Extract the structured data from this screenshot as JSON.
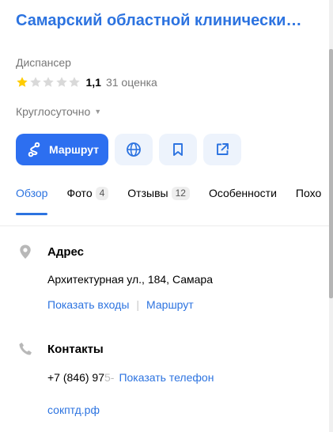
{
  "place": {
    "title": "Самарский областной клинический…",
    "category": "Диспансер",
    "rating_value": "1,1",
    "rating_count": "31 оценка",
    "rating_stars": 1,
    "hours": "Круглосуточно"
  },
  "actions": {
    "route_label": "Маршрут",
    "icons": [
      "route-icon",
      "globe-icon",
      "bookmark-icon",
      "share-icon"
    ]
  },
  "tabs": [
    {
      "label": "Обзор",
      "badge": null
    },
    {
      "label": "Фото",
      "badge": "4"
    },
    {
      "label": "Отзывы",
      "badge": "12"
    },
    {
      "label": "Особенности",
      "badge": null
    },
    {
      "label": "Похо",
      "badge": null
    }
  ],
  "address": {
    "title": "Адрес",
    "text": "Архитектурная ул., 184, Самара",
    "show_entrances": "Показать входы",
    "route_link": "Маршрут"
  },
  "contacts": {
    "title": "Контакты",
    "phone_visible": "+7 (846) 97",
    "phone_fade": "5-",
    "show_phone": "Показать телефон",
    "website": "сокптд.рф"
  },
  "colors": {
    "accent": "#2c73e0",
    "primary_button": "#2d6ff0",
    "star_active": "#fc0",
    "star_inactive": "#d9d9d9"
  }
}
